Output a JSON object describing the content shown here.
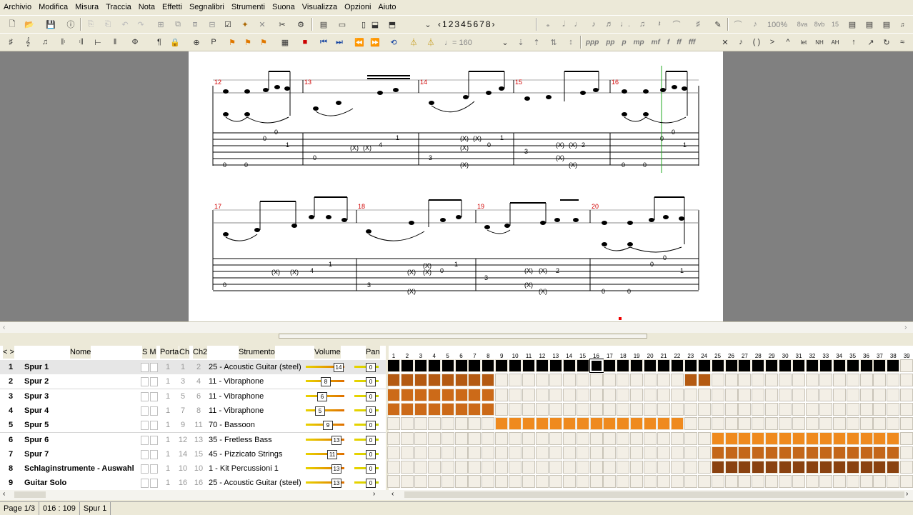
{
  "menu": [
    "Archivio",
    "Modifica",
    "Misura",
    "Traccia",
    "Nota",
    "Effetti",
    "Segnalibri",
    "Strumenti",
    "Suona",
    "Visualizza",
    "Opzioni",
    "Aiuto"
  ],
  "toolbar": {
    "pages": [
      "1",
      "2",
      "3",
      "4",
      "5",
      "6",
      "7",
      "8"
    ],
    "zoom": "100%",
    "tempo": "= 160",
    "dyn_labels": [
      "ppp",
      "pp",
      "p",
      "mp",
      "mf",
      "f",
      "ff",
      "fff"
    ]
  },
  "score": {
    "system1": {
      "measures": [
        "12",
        "13",
        "14",
        "15",
        "16"
      ]
    },
    "system2": {
      "measures": [
        "17",
        "18",
        "19",
        "20"
      ]
    }
  },
  "tracks": {
    "headers": {
      "nome": "Nome",
      "sm": "S M",
      "porta": "Porta",
      "ch": "Ch",
      "ch2": "Ch2",
      "strumento": "Strumento",
      "volume": "Volume",
      "pan": "Pan"
    },
    "rows": [
      {
        "num": "1",
        "name": "Spur 1",
        "porta": "1",
        "ch": "1",
        "ch2": "2",
        "instrument": "25 - Acoustic Guitar (steel)",
        "vol": "14",
        "pan": "0",
        "color": "#000000",
        "blocks": [
          1,
          38
        ]
      },
      {
        "num": "2",
        "name": "Spur 2",
        "porta": "1",
        "ch": "3",
        "ch2": "4",
        "instrument": "11 - Vibraphone",
        "vol": "8",
        "pan": "0",
        "color": "#b45a12",
        "blocks": [
          1,
          8
        ]
      },
      {
        "num": "3",
        "name": "Spur 3",
        "porta": "1",
        "ch": "5",
        "ch2": "6",
        "instrument": "11 - Vibraphone",
        "vol": "6",
        "pan": "0",
        "color": "#cc6a18",
        "blocks": [
          1,
          8
        ]
      },
      {
        "num": "4",
        "name": "Spur 4",
        "porta": "1",
        "ch": "7",
        "ch2": "8",
        "instrument": "11 - Vibraphone",
        "vol": "5",
        "pan": "0",
        "color": "#cc6a18",
        "blocks": [
          1,
          8
        ]
      },
      {
        "num": "5",
        "name": "Spur 5",
        "porta": "1",
        "ch": "9",
        "ch2": "11",
        "instrument": "70 - Bassoon",
        "vol": "9",
        "pan": "0",
        "color": "#ef8a1e",
        "blocks": [
          9,
          22
        ]
      },
      {
        "num": "6",
        "name": "Spur 6",
        "porta": "1",
        "ch": "12",
        "ch2": "13",
        "instrument": "35 - Fretless Bass",
        "vol": "13",
        "pan": "0",
        "color": "#ef8a1e",
        "blocks": [
          25,
          38
        ]
      },
      {
        "num": "7",
        "name": "Spur 7",
        "porta": "1",
        "ch": "14",
        "ch2": "15",
        "instrument": "45 - Pizzicato Strings",
        "vol": "11",
        "pan": "0",
        "color": "#c4671a",
        "blocks": [
          25,
          38
        ]
      },
      {
        "num": "8",
        "name": "Schlaginstrumente - Auswahl",
        "porta": "1",
        "ch": "10",
        "ch2": "10",
        "instrument": "1 - Kit Percussioni 1",
        "vol": "13",
        "pan": "0",
        "color": "#8a4210",
        "blocks": [
          25,
          38
        ]
      },
      {
        "num": "9",
        "name": "Guitar Solo",
        "porta": "1",
        "ch": "16",
        "ch2": "16",
        "instrument": "25 - Acoustic Guitar (steel)",
        "vol": "13",
        "pan": "0",
        "color": "#f3efe6",
        "blocks": []
      }
    ]
  },
  "status": {
    "page": "Page 1/3",
    "position": "016 : 109",
    "track": "Spur 1"
  }
}
